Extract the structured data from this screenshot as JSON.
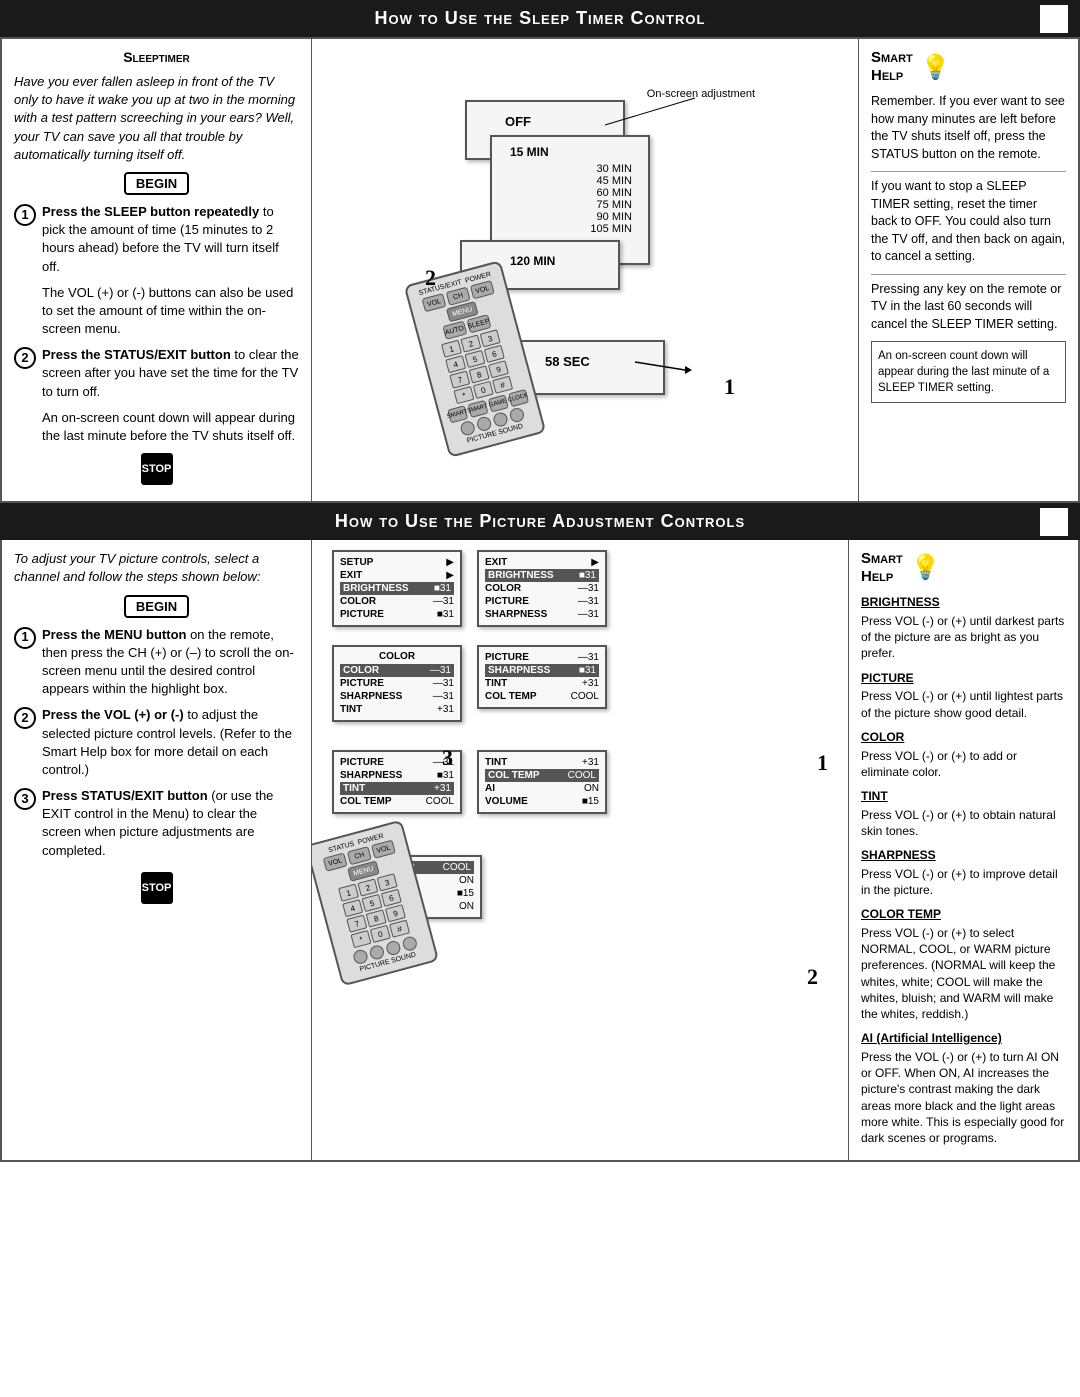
{
  "page": {
    "section1": {
      "title": "How to Use the Sleep Timer  Control",
      "left": {
        "panel_title": "Sleeptimer",
        "intro": "Have you ever fallen asleep in front of the TV only to have it wake you up at two in the morning with a test pattern screeching in your ears? Well, your TV can save you all that trouble by automatically turning itself off.",
        "begin_label": "BEGIN",
        "stop_label": "STOP",
        "step1_text": "Press the SLEEP button repeatedly to pick the amount of time (15 minutes to 2 hours ahead) before the TV will turn itself off.",
        "step1_extra": "The VOL (+) or (-) buttons can also be used to set the amount of time within the on-screen menu.",
        "step2_text": "Press the STATUS/EXIT button to clear the screen after you have set the time for the TV to turn off.",
        "step2_extra": "An on-screen count down will appear during the last minute before the TV shuts itself off."
      },
      "screen": {
        "label_onscreen": "On-screen adjustment",
        "times": [
          "OFF",
          "15 MIN",
          "30 MIN",
          "45 MIN",
          "60 MIN",
          "75 MIN",
          "90 MIN",
          "105 MIN",
          "120 MIN"
        ],
        "countdown": "58 SEC"
      },
      "right": {
        "title": "Smart\nHelp",
        "para1": "Remember.  If you ever want to see how many minutes are left before the TV shuts itself off, press the STATUS button on the remote.",
        "para2": "If you want to stop a SLEEP TIMER setting, reset the timer back to OFF. You could also turn the TV off, and then back on again, to cancel a setting.",
        "para3": "Pressing any key on the remote or TV in the last 60 seconds will cancel the SLEEP TIMER setting.",
        "note": "An on-screen count down will appear during the last minute of a SLEEP TIMER setting."
      }
    },
    "section2": {
      "title": "How to Use the Picture Adjustment Controls",
      "left": {
        "intro": "To adjust your TV picture controls, select a channel and follow the steps shown below:",
        "begin_label": "BEGIN",
        "stop_label": "STOP",
        "step1_text": "Press the MENU button on the remote, then press the CH (+) or (–) to scroll the on-screen menu until the desired control appears within the highlight box.",
        "step2_text": "Press the VOL (+) or (-) to adjust the selected picture control levels. (Refer to the Smart Help box for more detail on each control.)",
        "step3_text": "Press STATUS/EXIT button (or use the EXIT control in the Menu) to clear the screen when picture adjustments are completed."
      },
      "right": {
        "title": "Smart\nHelp",
        "brightness_title": "BRIGHTNESS",
        "brightness_text": "Press VOL (-) or (+) until darkest parts of the picture are as bright as you prefer.",
        "picture_title": "PICTURE",
        "picture_text": "Press VOL (-) or (+) until lightest parts of the picture show good detail.",
        "color_title": "COLOR",
        "color_text": "Press VOL (-) or (+) to add or eliminate color.",
        "tint_title": "TINT",
        "tint_text": "Press VOL (-) or (+) to obtain natural skin tones.",
        "sharpness_title": "SHARPNESS",
        "sharpness_text": "Press VOL (-) or (+) to improve detail in the picture.",
        "colortemp_title": "COLOR TEMP",
        "colortemp_text": "Press VOL (-) or (+) to select NORMAL, COOL, or WARM picture preferences. (NORMAL will keep the whites, white; COOL will make the whites, bluish; and WARM will make the whites, reddish.)",
        "ai_title": "AI (Artificial Intelligence)",
        "ai_text": "Press the VOL (-) or (+) to turn AI ON or OFF. When ON, AI increases the picture's contrast making the dark areas more black and the light areas more white. This is especially good for dark scenes or programs."
      },
      "menus": {
        "menu1": {
          "rows": [
            {
              "label": "SETUP",
              "value": "▶"
            },
            {
              "label": "EXIT",
              "value": "▶"
            },
            {
              "label": "BRIGHTNESS",
              "value": "■ 31",
              "highlight": true
            },
            {
              "label": "COLOR",
              "value": "— 31"
            },
            {
              "label": "PICTURE",
              "value": "■ 31"
            },
            {
              "label": "",
              "value": ""
            }
          ]
        }
      }
    }
  }
}
